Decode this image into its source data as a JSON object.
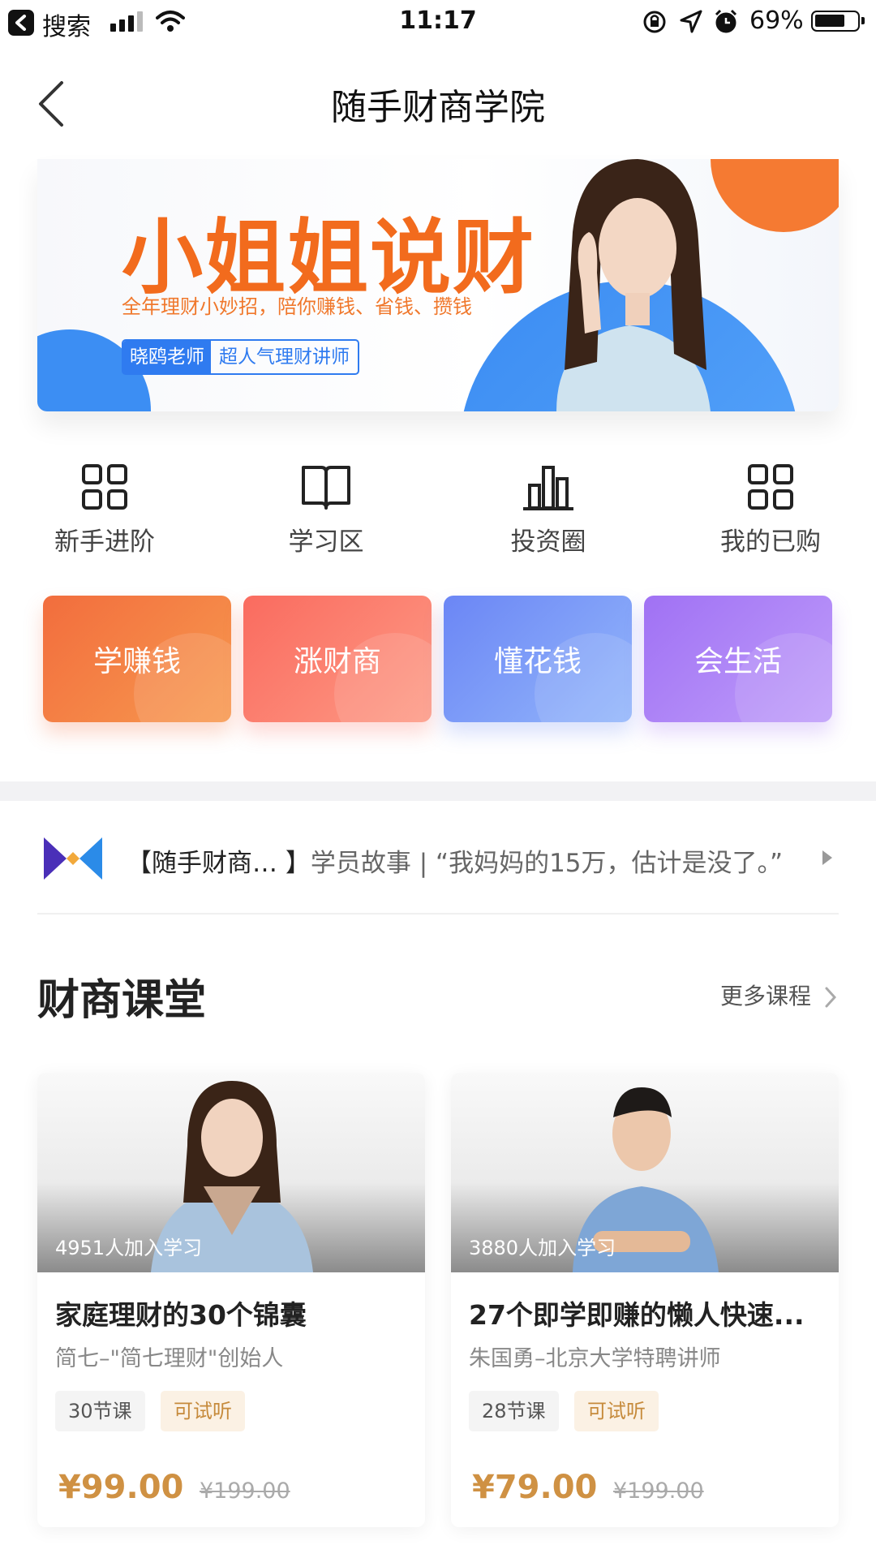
{
  "status_bar": {
    "back_app_label": "搜索",
    "time": "11:17",
    "battery": "69%"
  },
  "nav": {
    "title": "随手财商学院"
  },
  "banner": {
    "title": "小姐姐说财",
    "subtitle": "全年理财小妙招，陪你赚钱、省钱、攒钱",
    "tag_teacher": "晓鸥老师",
    "tag_role": "超人气理财讲师"
  },
  "quick_entries": [
    {
      "label": "新手进阶",
      "icon": "grid-icon"
    },
    {
      "label": "学习区",
      "icon": "book-icon"
    },
    {
      "label": "投资圈",
      "icon": "bar-chart-icon"
    },
    {
      "label": "我的已购",
      "icon": "grid-icon"
    }
  ],
  "categories": [
    {
      "label": "学赚钱",
      "color_from": "#f26d3d",
      "color_to": "#f7994f"
    },
    {
      "label": "涨财商",
      "color_from": "#fa6b5f",
      "color_to": "#fd9a85"
    },
    {
      "label": "懂花钱",
      "color_from": "#6b86f5",
      "color_to": "#93b6fb"
    },
    {
      "label": "会生活",
      "color_from": "#a071f4",
      "color_to": "#bf9dfa"
    }
  ],
  "news": {
    "source": "【随手财商…  】",
    "headline": "学员故事 | “我妈妈的15万，估计是没了。”"
  },
  "section": {
    "title": "财商课堂",
    "more_label": "更多课程"
  },
  "courses": [
    {
      "learners": "4951人加入学习",
      "title": "家庭理财的30个锦囊",
      "author": "简七–\"简七理财\"创始人",
      "lessons": "30节课",
      "trial": "可试听",
      "price": "¥99.00",
      "original_price": "¥199.00"
    },
    {
      "learners": "3880人加入学习",
      "title": "27个即学即赚的懒人快速...",
      "author": "朱国勇–北京大学特聘讲师",
      "lessons": "28节课",
      "trial": "可试听",
      "price": "¥79.00",
      "original_price": "¥199.00"
    }
  ]
}
